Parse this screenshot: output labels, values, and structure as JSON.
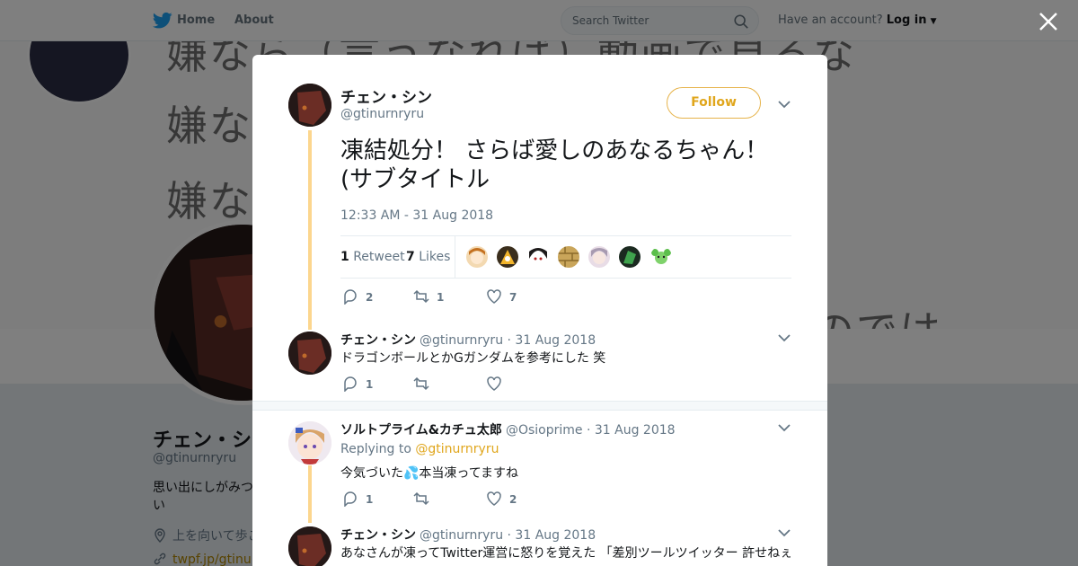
{
  "nav": {
    "home_label": "Home",
    "about_label": "About",
    "search_placeholder": "Search Twitter",
    "account_prompt": "Have an account?",
    "login_label": "Log in"
  },
  "background": {
    "banner_lines": [
      "嫌なら（言うなれば）動画で見るな",
      "嫌な",
      "嫌な",
      "のでは"
    ],
    "profile_name": "チェン・シ",
    "profile_handle": "@gtinurnryru",
    "bio": "思い出にしがみつ い",
    "location": "上を向いて歩こ",
    "url": "twpf.jp/gtinurn"
  },
  "tweet": {
    "author_name": "チェン・シン",
    "author_handle": "@gtinurnryru",
    "follow_label": "Follow",
    "text": "凍結処分！ さらば愛しのあなるちゃん！ (サブタイトル",
    "timestamp": "12:33 AM - 31 Aug 2018",
    "retweet_count": "1",
    "retweet_label": "Retweet",
    "likes_count": "7",
    "likes_label": "Likes",
    "reply_action_count": "2",
    "retweet_action_count": "1",
    "like_action_count": "7"
  },
  "replies": [
    {
      "name": "チェン・シン",
      "handle": "@gtinurnryru",
      "date": "· 31 Aug 2018",
      "text": "ドラゴンボールとかGガンダムを参考にした 笑",
      "reply_count": "1",
      "retweet_count": "",
      "like_count": ""
    },
    {
      "name": "ソルトプライム&カチュ太郎",
      "handle": "@Osioprime",
      "date": "· 31 Aug 2018",
      "replying_prefix": "Replying to",
      "replying_to": "@gtinurnryru",
      "text": "今気づいた💦本当凍ってますね",
      "reply_count": "1",
      "retweet_count": "",
      "like_count": "2"
    },
    {
      "name": "チェン・シン",
      "handle": "@gtinurnryru",
      "date": "· 31 Aug 2018",
      "text": "あなさんが凍ってTwitter運営に怒りを覚えた 「差別ツールツイッター 許せねぇ"
    }
  ],
  "icons": {
    "bird": "twitter-bird-icon",
    "search": "search-icon",
    "close": "close-icon",
    "reply": "reply-icon",
    "retweet": "retweet-icon",
    "like": "heart-icon",
    "chevron": "chevron-down-icon"
  },
  "colors": {
    "accent": "#e0a61c",
    "thread_line": "#fcd68e",
    "secondary_text": "#657786"
  }
}
